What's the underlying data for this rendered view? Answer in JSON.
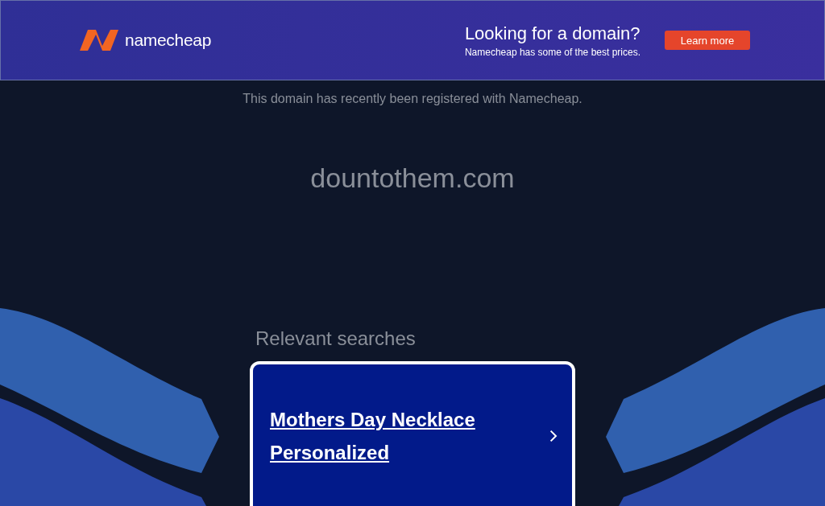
{
  "banner": {
    "brand": "namecheap",
    "headline": "Looking for a domain?",
    "subline": "Namecheap has some of the best prices.",
    "button": "Learn more"
  },
  "notice": "This domain has recently been registered with Namecheap.",
  "domain": "dountothem.com",
  "searches": {
    "title": "Relevant searches",
    "items": [
      {
        "label": "Mothers Day Necklace Personalized"
      }
    ]
  }
}
